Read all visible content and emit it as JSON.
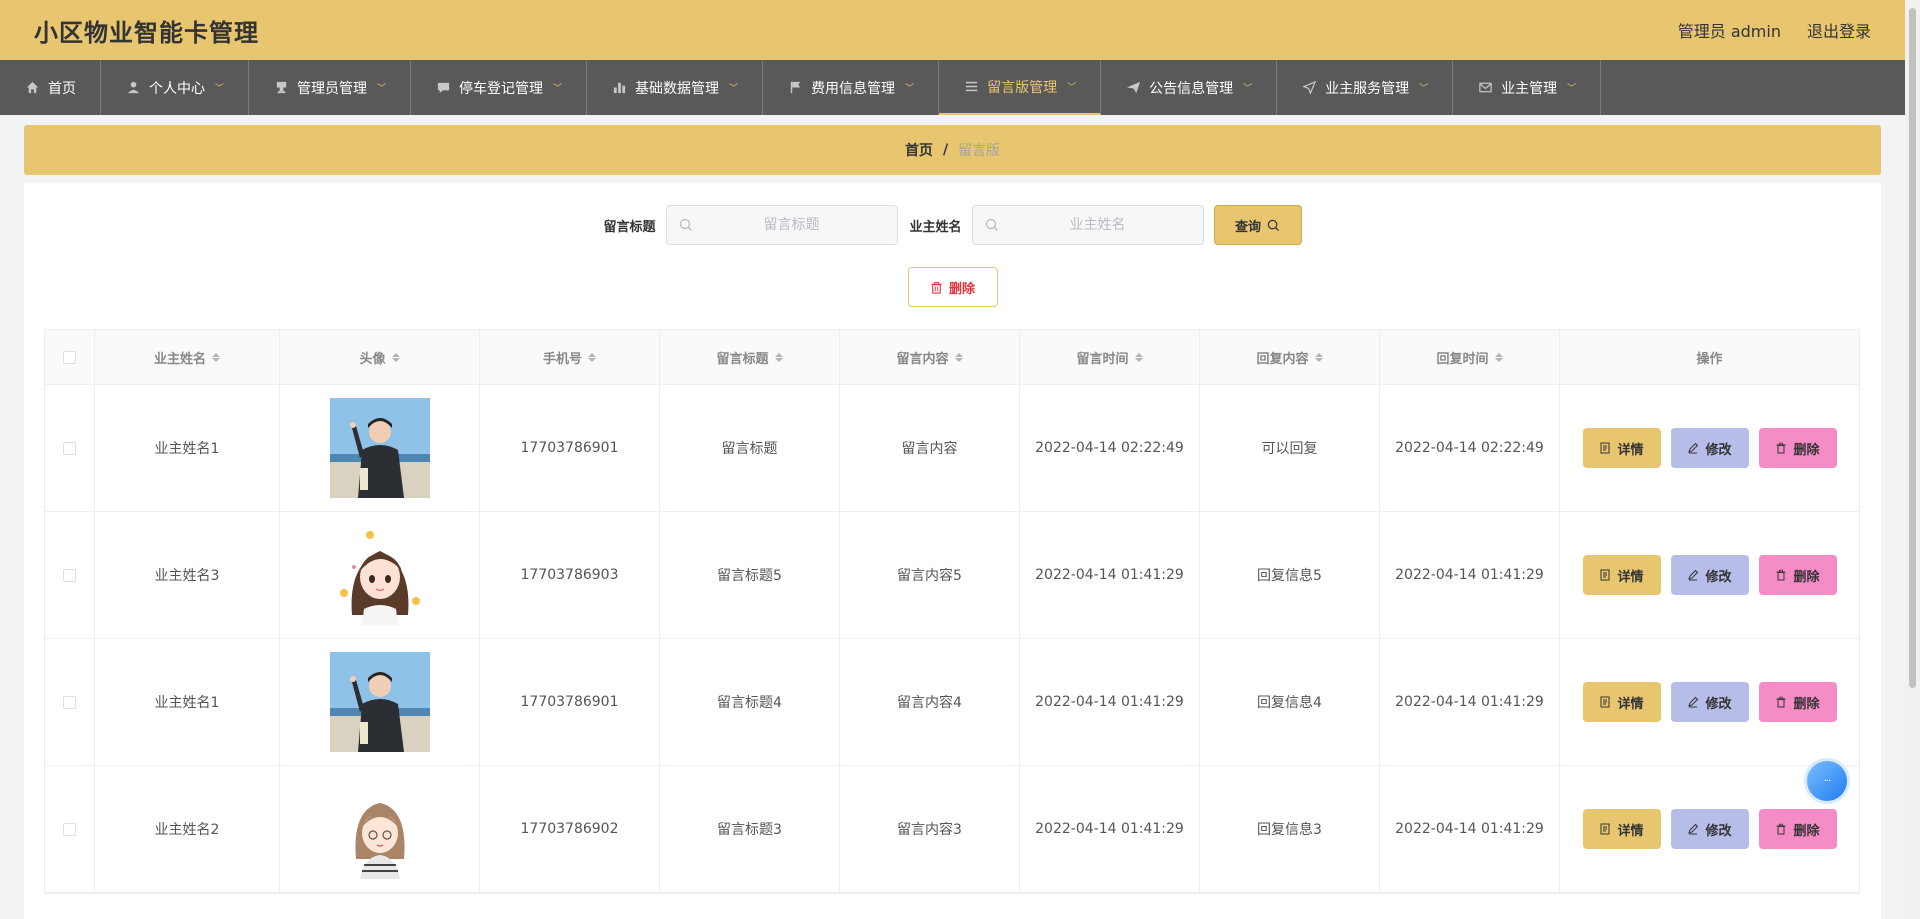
{
  "header": {
    "title": "小区物业智能卡管理",
    "user": "管理员 admin",
    "logout": "退出登录"
  },
  "nav": [
    {
      "label": "首页",
      "icon": "home-icon",
      "dropdown": false
    },
    {
      "label": "个人中心",
      "icon": "user-icon",
      "dropdown": true
    },
    {
      "label": "管理员管理",
      "icon": "stamp-icon",
      "dropdown": true
    },
    {
      "label": "停车登记管理",
      "icon": "chat-icon",
      "dropdown": true
    },
    {
      "label": "基础数据管理",
      "icon": "bar-chart-icon",
      "dropdown": true
    },
    {
      "label": "费用信息管理",
      "icon": "flag-icon",
      "dropdown": true
    },
    {
      "label": "留言版管理",
      "icon": "menu-icon",
      "dropdown": true,
      "active": true
    },
    {
      "label": "公告信息管理",
      "icon": "paper-plane-icon",
      "dropdown": true
    },
    {
      "label": "业主服务管理",
      "icon": "navigation-icon",
      "dropdown": true
    },
    {
      "label": "业主管理",
      "icon": "mail-icon",
      "dropdown": true
    }
  ],
  "breadcrumb": {
    "home": "首页",
    "sep": "/",
    "current": "留言版"
  },
  "search": {
    "title_label": "留言标题",
    "title_placeholder": "留言标题",
    "owner_label": "业主姓名",
    "owner_placeholder": "业主姓名",
    "query_label": "查询"
  },
  "bulk_delete_label": "删除",
  "table": {
    "columns": [
      "业主姓名",
      "头像",
      "手机号",
      "留言标题",
      "留言内容",
      "留言时间",
      "回复内容",
      "回复时间",
      "操作"
    ],
    "rows": [
      {
        "name": "业主姓名1",
        "avatar": "boy",
        "phone": "17703786901",
        "title": "留言标题",
        "content": "留言内容",
        "time": "2022-04-14 02:22:49",
        "reply": "可以回复",
        "reply_time": "2022-04-14 02:22:49"
      },
      {
        "name": "业主姓名3",
        "avatar": "girl",
        "phone": "17703786903",
        "title": "留言标题5",
        "content": "留言内容5",
        "time": "2022-04-14 01:41:29",
        "reply": "回复信息5",
        "reply_time": "2022-04-14 01:41:29"
      },
      {
        "name": "业主姓名1",
        "avatar": "boy",
        "phone": "17703786901",
        "title": "留言标题4",
        "content": "留言内容4",
        "time": "2022-04-14 01:41:29",
        "reply": "回复信息4",
        "reply_time": "2022-04-14 01:41:29"
      },
      {
        "name": "业主姓名2",
        "avatar": "girl2",
        "phone": "17703786902",
        "title": "留言标题3",
        "content": "留言内容3",
        "time": "2022-04-14 01:41:29",
        "reply": "回复信息3",
        "reply_time": "2022-04-14 01:41:29"
      }
    ],
    "actions": {
      "detail": "详情",
      "edit": "修改",
      "delete": "删除"
    }
  },
  "colors": {
    "accent": "#e8c670",
    "nav_bg": "#595959",
    "edit": "#b7bde9",
    "delete": "#f68cc7",
    "danger_text": "#e6343c"
  }
}
